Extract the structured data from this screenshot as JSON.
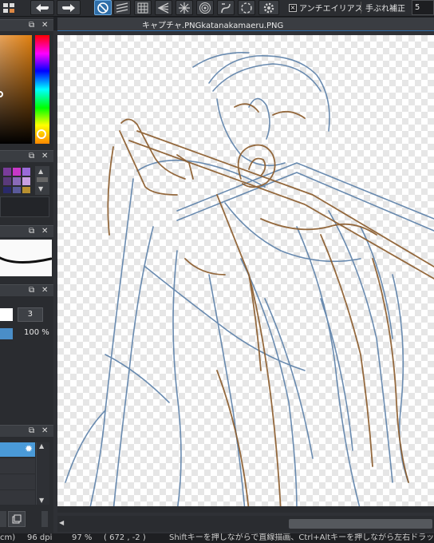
{
  "toolbar": {
    "icons": [
      "layer-panel-icon",
      "undo-icon",
      "redo-icon",
      "snap-off-icon",
      "parallel-snap-icon",
      "grid-snap-icon",
      "vanishing-point-icon",
      "radial-snap-icon",
      "concentric-snap-icon",
      "curve-snap-icon",
      "ellipse-snap-icon",
      "snap-settings-icon"
    ],
    "antialias_label": "アンチエイリアス",
    "antialias_checked": "×",
    "stabilizer_label": "手ぶれ補正",
    "stabilizer_value": "5"
  },
  "document": {
    "tab_title": "キャプチャ.PNGkatanakamaeru.PNG"
  },
  "left_panels": {
    "brush_size_value": "3",
    "opacity_value": "100 %",
    "swatch_colors": [
      "#7a3c9a",
      "#c838c8",
      "#9a6ad8",
      "#5a3a7a",
      "#8a6ab8",
      "#c8a0e0",
      "#2a2a6a",
      "#5a5a9a",
      "#b89030"
    ]
  },
  "statusbar": {
    "unit": "cm)",
    "dpi": "96 dpi",
    "zoom": "97 %",
    "coords": "( 672 , -2 )",
    "hint": "Shiftキーを押しながらで直線描画、Ctrl+Altキーを押しながら左右ドラッグで"
  },
  "colors": {
    "accent": "#2f6ea8",
    "panel_bg": "#2a2c30",
    "sketch_brown": "#8a5a2a",
    "sketch_blue": "#5a7fa8"
  }
}
